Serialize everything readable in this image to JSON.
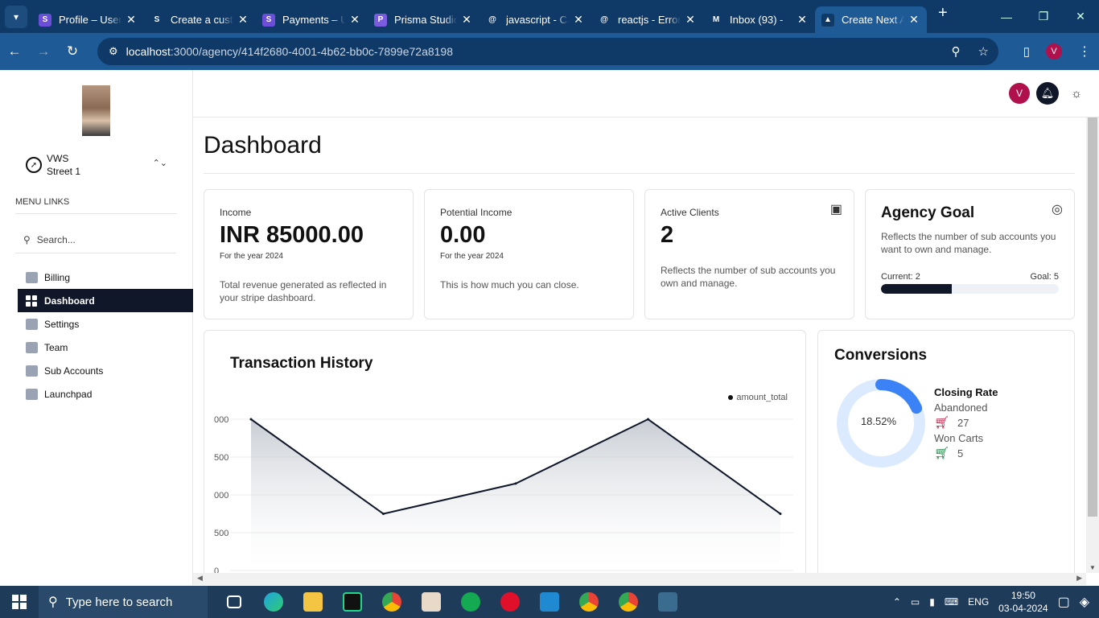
{
  "browser": {
    "tabs": [
      {
        "title": "Profile – User",
        "fav_color": "#6b4fd8",
        "fav_text": "S"
      },
      {
        "title": "Create a custom",
        "fav_color": "#0f3a67",
        "fav_text": "S"
      },
      {
        "title": "Payments – Users",
        "fav_color": "#6b4fd8",
        "fav_text": "S"
      },
      {
        "title": "Prisma Studio",
        "fav_color": "#7b5be0",
        "fav_text": "P"
      },
      {
        "title": "javascript - Cann",
        "fav_color": "#0f3a67",
        "fav_text": "@"
      },
      {
        "title": "reactjs - Error",
        "fav_color": "#0f3a67",
        "fav_text": "@"
      },
      {
        "title": "Inbox (93) - ",
        "fav_color": "#0f3a67",
        "fav_text": "M"
      },
      {
        "title": "Create Next App",
        "fav_color": "#0f3a67",
        "fav_text": "▲"
      }
    ],
    "url_host": "localhost",
    "url_path": ":3000/agency/414f2680-4001-4b62-bb0c-7899e72a8198",
    "profile_initial": "V"
  },
  "sidebar": {
    "account_name": "VWS",
    "account_sub": "Street 1",
    "menu_links_label": "MENU LINKS",
    "search_placeholder": "Search...",
    "items": [
      {
        "label": "Billing",
        "icon": "billing-icon"
      },
      {
        "label": "Dashboard",
        "icon": "dashboard-icon",
        "active": true
      },
      {
        "label": "Settings",
        "icon": "settings-icon"
      },
      {
        "label": "Team",
        "icon": "shield-icon"
      },
      {
        "label": "Sub Accounts",
        "icon": "person-icon"
      },
      {
        "label": "Launchpad",
        "icon": "clipboard-icon"
      }
    ]
  },
  "topbar": {
    "avatar_initial": "V"
  },
  "page": {
    "title": "Dashboard"
  },
  "cards": {
    "income": {
      "label": "Income",
      "value": "INR 85000.00",
      "year": "For the year 2024",
      "desc": "Total revenue generated as reflected in your stripe dashboard."
    },
    "potential": {
      "label": "Potential Income",
      "value": "0.00",
      "year": "For the year 2024",
      "desc": "This is how much you can close."
    },
    "clients": {
      "label": "Active Clients",
      "value": "2",
      "desc": "Reflects the number of sub accounts you own and manage."
    },
    "goal": {
      "title": "Agency Goal",
      "desc": "Reflects the number of sub accounts you want to own and manage.",
      "current": "Current: 2",
      "goal": "Goal: 5",
      "progress": 0.4
    }
  },
  "transactions": {
    "title": "Transaction History",
    "legend": "amount_total"
  },
  "chart_data": {
    "type": "area",
    "title": "Transaction History",
    "series": [
      {
        "name": "amount_total",
        "values": [
          2000,
          750,
          1150,
          2000,
          750
        ]
      }
    ],
    "x": [
      0,
      1,
      2,
      3,
      4
    ],
    "yticks": [
      "000",
      "500",
      "000",
      "500",
      "0"
    ],
    "ylim": [
      0,
      2000
    ],
    "grid": true,
    "legend": "top-right",
    "color": "#0f1729"
  },
  "conversions": {
    "title": "Conversions",
    "rate_text": "18.52%",
    "rate": 0.1852,
    "closing_label": "Closing Rate",
    "abandoned_label": "Abandoned",
    "abandoned_count": "27",
    "won_label": "Won Carts",
    "won_count": "5",
    "colors": {
      "ring": "#dbeafe",
      "fill": "#3b82f6",
      "abandoned": "#be123c",
      "won": "#15803d"
    }
  },
  "taskbar": {
    "search_placeholder": "Type here to search",
    "lang": "ENG",
    "time": "19:50",
    "date": "03-04-2024"
  }
}
